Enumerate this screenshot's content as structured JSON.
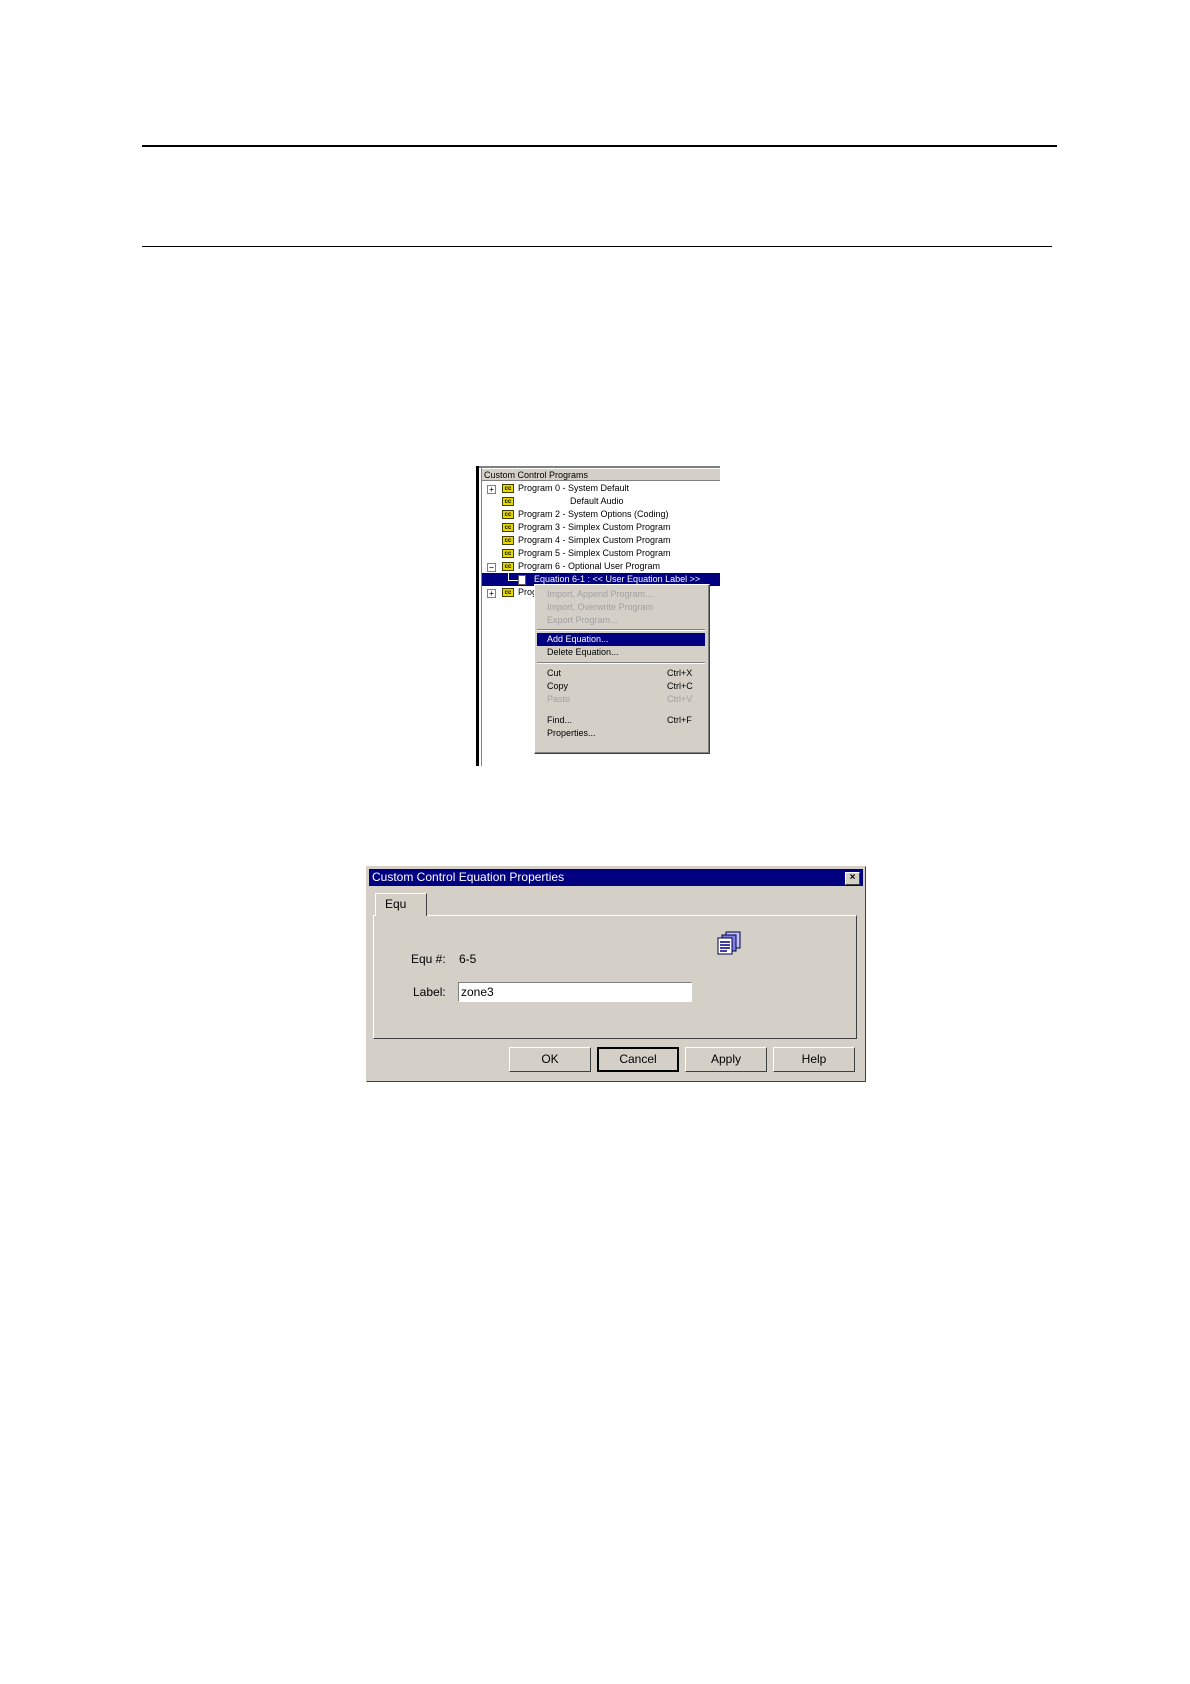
{
  "tree": {
    "header": "Custom Control Programs",
    "rows": [
      {
        "expander": "+",
        "icon": "cc",
        "label": "Program 0 - System Default"
      },
      {
        "expander": "",
        "icon": "cc",
        "label": "Default Audio"
      },
      {
        "expander": "",
        "icon": "cc",
        "label": "Program 2 - System Options (Coding)"
      },
      {
        "expander": "",
        "icon": "cc",
        "label": "Program 3 - Simplex Custom Program"
      },
      {
        "expander": "",
        "icon": "cc",
        "label": "Program 4 - Simplex Custom Program"
      },
      {
        "expander": "",
        "icon": "cc",
        "label": "Program 5 - Simplex Custom Program"
      },
      {
        "expander": "-",
        "icon": "cc",
        "label": "Program 6 - Optional User Program"
      },
      {
        "expander": "",
        "icon": "doc",
        "label": "Equation 6-1 : << User Equation Label >>"
      },
      {
        "expander": "+",
        "icon": "cc",
        "label": "Prog"
      }
    ],
    "expander_minus": "−",
    "icon_text": "cc"
  },
  "context_menu": {
    "items": [
      {
        "label": "Import, Append Program...",
        "shortcut": "",
        "disabled": true
      },
      {
        "label": "Import, Overwrite Program",
        "shortcut": "",
        "disabled": true
      },
      {
        "label": "Export Program...",
        "shortcut": "",
        "disabled": true
      },
      {
        "label": "Add Equation...",
        "shortcut": "",
        "highlight": true
      },
      {
        "label": "Delete Equation...",
        "shortcut": ""
      },
      {
        "label": "Cut",
        "shortcut": "Ctrl+X"
      },
      {
        "label": "Copy",
        "shortcut": "Ctrl+C"
      },
      {
        "label": "Paste",
        "shortcut": "Ctrl+V",
        "disabled": true
      },
      {
        "label": "Find...",
        "shortcut": "Ctrl+F"
      },
      {
        "label": "Properties...",
        "shortcut": ""
      }
    ]
  },
  "dialog": {
    "title": "Custom Control Equation Properties",
    "close": "×",
    "tab_label": "Equ",
    "equ_label": "Equ #:",
    "equ_value": "6-5",
    "label_label": "Label:",
    "label_value": "zone3",
    "buttons": {
      "ok": "OK",
      "cancel": "Cancel",
      "apply": "Apply",
      "help": "Help"
    }
  },
  "colors": {
    "selection": "#000080",
    "window_bg": "#d4d0c8",
    "icon_yellow": "#e8d800"
  }
}
